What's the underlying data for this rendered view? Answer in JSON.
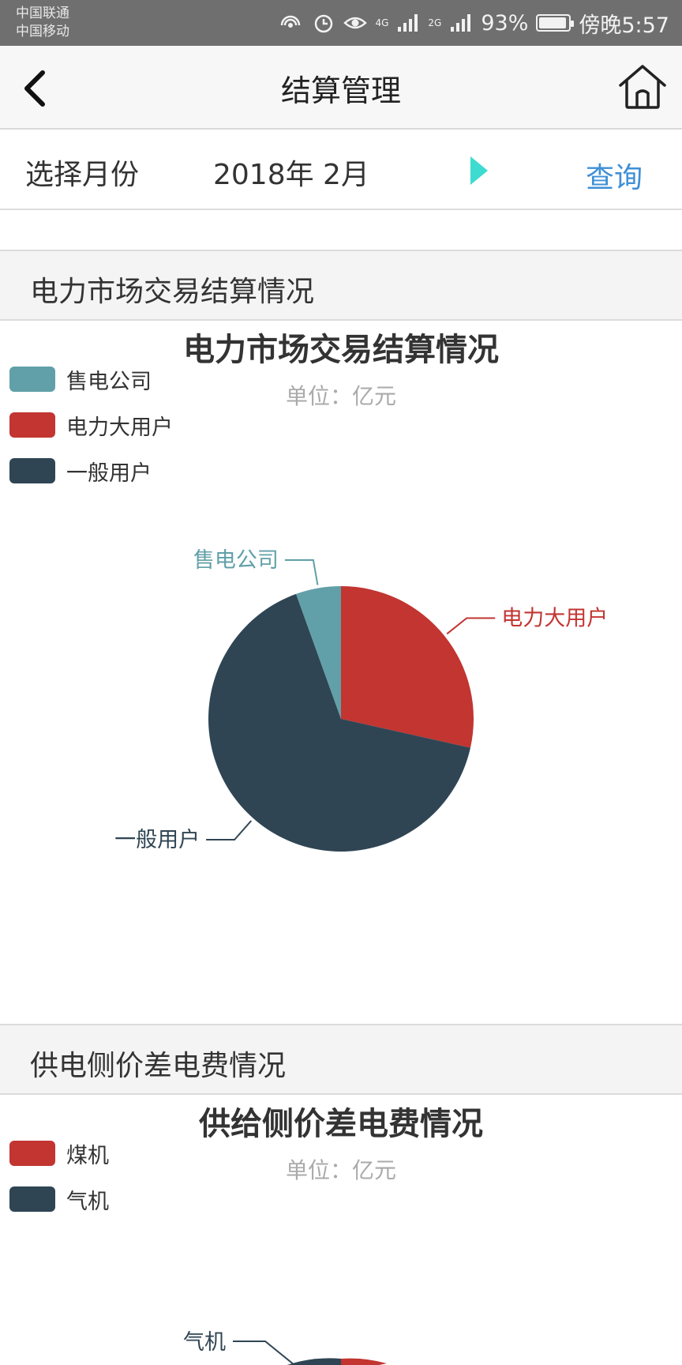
{
  "status_bar": {
    "carrier1": "中国联通",
    "carrier2": "中国移动",
    "net1": "4G",
    "net2": "2G",
    "battery": "93%",
    "battery_level": 0.93,
    "time": "傍晚5:57"
  },
  "nav": {
    "title": "结算管理",
    "back_icon": "chevron-left-icon",
    "home_icon": "home-icon"
  },
  "month_selector": {
    "label": "选择月份",
    "value": "2018年 2月",
    "next_icon": "play-triangle-icon",
    "query": "查询"
  },
  "sections": [
    {
      "header": "电力市场交易结算情况",
      "chart_title": "电力市场交易结算情况",
      "unit": "单位：亿元"
    },
    {
      "header": "供电侧价差电费情况",
      "chart_title": "供给侧价差电费情况",
      "unit": "单位：亿元"
    }
  ],
  "colors": {
    "teal": "#61a0a8",
    "red": "#c23531",
    "navy": "#2f4554",
    "accent_blue": "#3e8fd6",
    "arrow_cyan": "#3ddbd0"
  },
  "chart_data": [
    {
      "type": "pie",
      "title": "电力市场交易结算情况",
      "subtitle": "单位：亿元",
      "legend": [
        "售电公司",
        "电力大用户",
        "一般用户"
      ],
      "legend_position": "top-left",
      "series": [
        {
          "name": "售电公司",
          "value": 0.055,
          "color": "#61a0a8"
        },
        {
          "name": "电力大用户",
          "value": 0.285,
          "color": "#c23531"
        },
        {
          "name": "一般用户",
          "value": 0.66,
          "color": "#2f4554"
        }
      ]
    },
    {
      "type": "pie",
      "title": "供给侧价差电费情况",
      "subtitle": "单位：亿元",
      "legend": [
        "煤机",
        "气机"
      ],
      "legend_position": "top-left",
      "visible_labels": [
        "气机"
      ],
      "series": [
        {
          "name": "煤机",
          "color": "#c23531"
        },
        {
          "name": "气机",
          "color": "#2f4554"
        }
      ]
    }
  ]
}
